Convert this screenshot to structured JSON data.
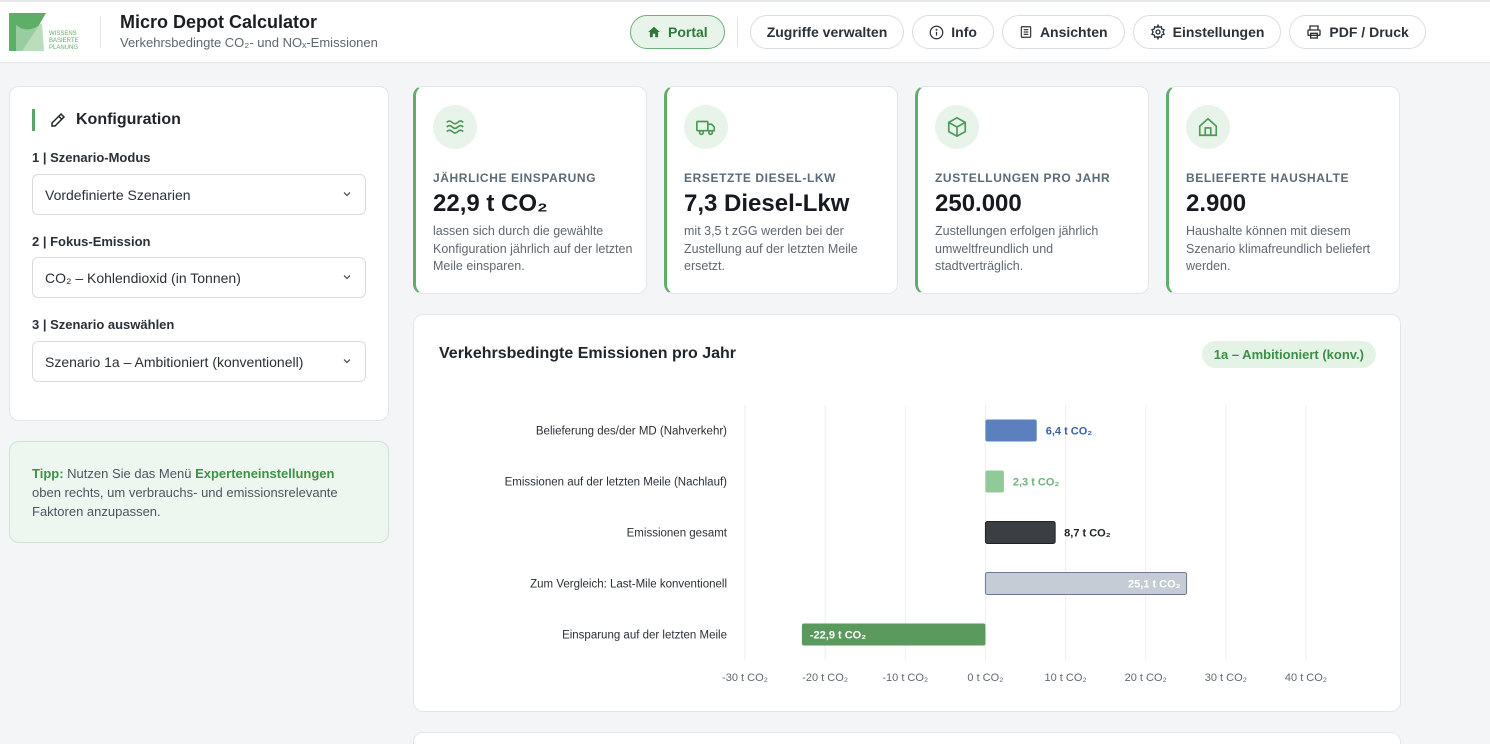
{
  "app": {
    "title": "Micro Depot Calculator",
    "subtitle": "Verkehrsbedingte CO₂- und NOₓ-Emissionen",
    "logo_text": [
      "WISSENS",
      "BASIERTE",
      "PLANUNG"
    ]
  },
  "nav": {
    "portal": "Portal",
    "access": "Zugriffe verwalten",
    "info": "Info",
    "views": "Ansichten",
    "settings": "Einstellungen",
    "print": "PDF / Druck"
  },
  "config": {
    "title": "Konfiguration",
    "fields": [
      {
        "label": "1 | Szenario-Modus",
        "value": "Vordefinierte Szenarien"
      },
      {
        "label": "2 | Fokus-Emission",
        "value": "CO₂ – Kohlendioxid (in Tonnen)"
      },
      {
        "label": "3 | Szenario auswählen",
        "value": "Szenario 1a – Ambitioniert (konventionell)"
      }
    ]
  },
  "tip": {
    "prefix": "Tipp:",
    "text1": " Nutzen Sie das Menü ",
    "highlight": "Experteneinstellungen",
    "text2": " oben rechts, um verbrauchs- und emissionsrelevante Faktoren anzupassen."
  },
  "kpis": [
    {
      "icon": "waves-icon",
      "label": "Jährliche Einsparung",
      "value": "22,9 t CO₂",
      "desc": "lassen sich durch die gewählte Konfiguration jährlich auf der letzten Meile einsparen."
    },
    {
      "icon": "truck-icon",
      "label": "Ersetzte Diesel-Lkw",
      "value": "7,3 Diesel-Lkw",
      "desc": "mit 3,5 t zGG werden bei der Zustellung auf der letzten Meile ersetzt."
    },
    {
      "icon": "package-icon",
      "label": "Zustellungen pro Jahr",
      "value": "250.000",
      "desc": "Zustellungen erfolgen jährlich umweltfreundlich und stadtverträglich."
    },
    {
      "icon": "home-icon",
      "label": "Belieferte Haushalte",
      "value": "2.900",
      "desc": "Haushalte können mit diesem Szenario klimafreundlich beliefert werden."
    }
  ],
  "chart": {
    "title": "Verkehrsbedingte Emissionen pro Jahr",
    "badge": "1a – Ambitioniert (konv.)"
  },
  "chart_data": {
    "type": "bar",
    "orientation": "horizontal",
    "categories": [
      "Belieferung des/der MD (Nahverkehr)",
      "Emissionen auf der letzten Meile (Nachlauf)",
      "Emissionen gesamt",
      "Zum Vergleich: Last-Mile konventionell",
      "Einsparung auf der letzten Meile"
    ],
    "values": [
      6.4,
      2.3,
      8.7,
      25.1,
      -22.9
    ],
    "value_labels": [
      "6,4 t CO₂",
      "2,3 t CO₂",
      "8,7 t CO₂",
      "25,1 t CO₂",
      "-22,9 t CO₂"
    ],
    "colors": [
      "#5b80bd",
      "#8fca98",
      "#3b3f44",
      "#c5ccd6",
      "#5a9a5d"
    ],
    "label_colors": [
      "#3a5fa8",
      "#6db477",
      "#1f2328",
      "#ffffff",
      "#ffffff"
    ],
    "xlim": [
      -30,
      40
    ],
    "xticks": [
      -30,
      -20,
      -10,
      0,
      10,
      20,
      30,
      40
    ],
    "xtick_labels": [
      "-30 t CO₂",
      "-20 t CO₂",
      "-10 t CO₂",
      "0 t CO₂",
      "10 t CO₂",
      "20 t CO₂",
      "30 t CO₂",
      "40 t CO₂"
    ],
    "grid": true
  }
}
